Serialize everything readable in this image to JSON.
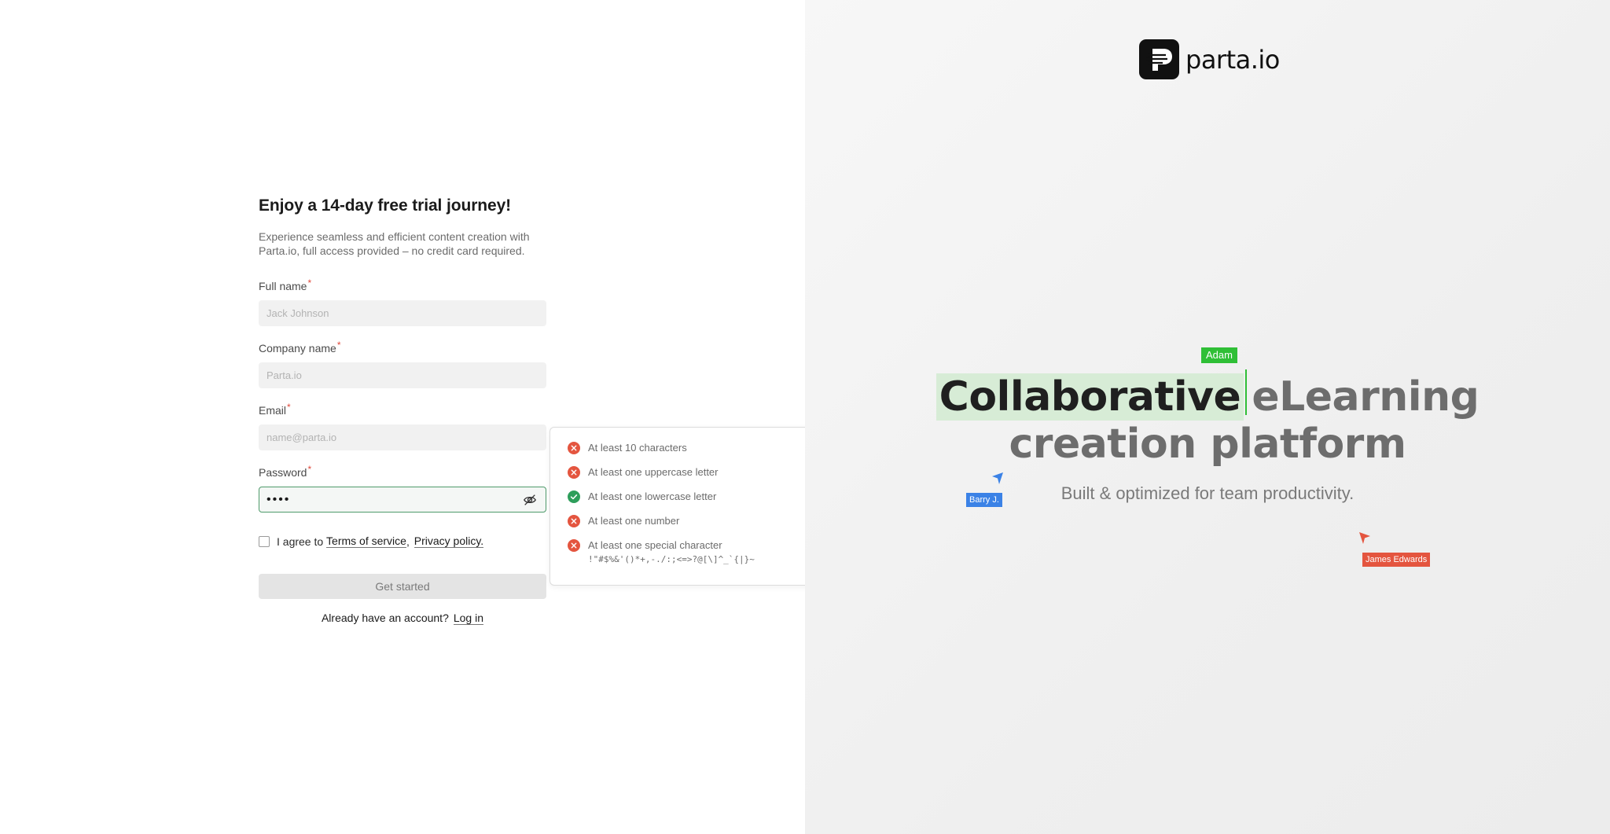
{
  "signup": {
    "title": "Enjoy a 14-day free trial journey!",
    "lead": "Experience seamless and efficient content creation with Parta.io, full access provided – no credit card required.",
    "required_mark": "*",
    "full_name": {
      "label": "Full name",
      "placeholder": "Jack Johnson",
      "value": ""
    },
    "company": {
      "label": "Company name",
      "placeholder": "Parta.io",
      "value": ""
    },
    "email": {
      "label": "Email",
      "placeholder": "name@parta.io",
      "value": ""
    },
    "password": {
      "label": "Password",
      "value": "••••"
    },
    "agree": {
      "prefix": "I agree to",
      "terms": "Terms of service",
      "separator": ",",
      "privacy": "Privacy policy.",
      "checked": false
    },
    "submit_label": "Get started",
    "login_prompt": "Already have an account?",
    "login_link": "Log in"
  },
  "password_rules": [
    {
      "text": "At least 10 characters",
      "status": "fail"
    },
    {
      "text": "At least one uppercase letter",
      "status": "fail"
    },
    {
      "text": "At least one lowercase letter",
      "status": "pass"
    },
    {
      "text": "At least one number",
      "status": "fail"
    },
    {
      "text": "At least one special character",
      "detail": "!\"#$%&'()*+,-./:;<=>?@[\\]^_`{|}~",
      "status": "fail"
    }
  ],
  "brand": {
    "name": "parta.io"
  },
  "hero": {
    "highlight_word": "Collaborative",
    "rest_line1": "eLearning",
    "line2": "creation platform",
    "tagline": "Built & optimized for team productivity."
  },
  "collaborators": [
    {
      "name": "Adam",
      "color": "#2fbf36"
    },
    {
      "name": "Barry J.",
      "color": "#3b82e6"
    },
    {
      "name": "James Edwards",
      "color": "#e4553f"
    }
  ],
  "colors": {
    "fail": "#e4553f",
    "pass": "#2e9e5b",
    "focus_border": "#4f9b6b"
  }
}
